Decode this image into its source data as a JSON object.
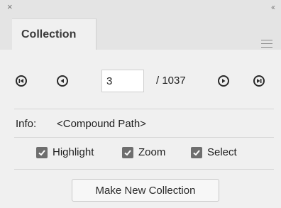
{
  "titlebar": {
    "close_glyph": "×",
    "collapse_glyph": "‹‹"
  },
  "tab": {
    "label": "Collection"
  },
  "icons": {
    "close": "close-icon",
    "collapse": "collapse-panel-icon",
    "menu": "hamburger-menu-icon",
    "first": "skip-to-first-icon",
    "prev": "previous-icon",
    "next": "next-icon",
    "last": "skip-to-last-icon",
    "check": "checkmark-icon"
  },
  "navigator": {
    "current_page": "3",
    "total": "/ 1037"
  },
  "info": {
    "label": "Info:",
    "value": "<Compound Path>"
  },
  "options": {
    "highlight": {
      "label": "Highlight",
      "checked": true
    },
    "zoom": {
      "label": "Zoom",
      "checked": true
    },
    "select": {
      "label": "Select",
      "checked": true
    }
  },
  "actions": {
    "make_collection": "Make New Collection"
  },
  "colors": {
    "panel_bg": "#f0f0f0",
    "header_bg": "#e4e4e4",
    "checkbox_fill": "#6e6e6e"
  }
}
